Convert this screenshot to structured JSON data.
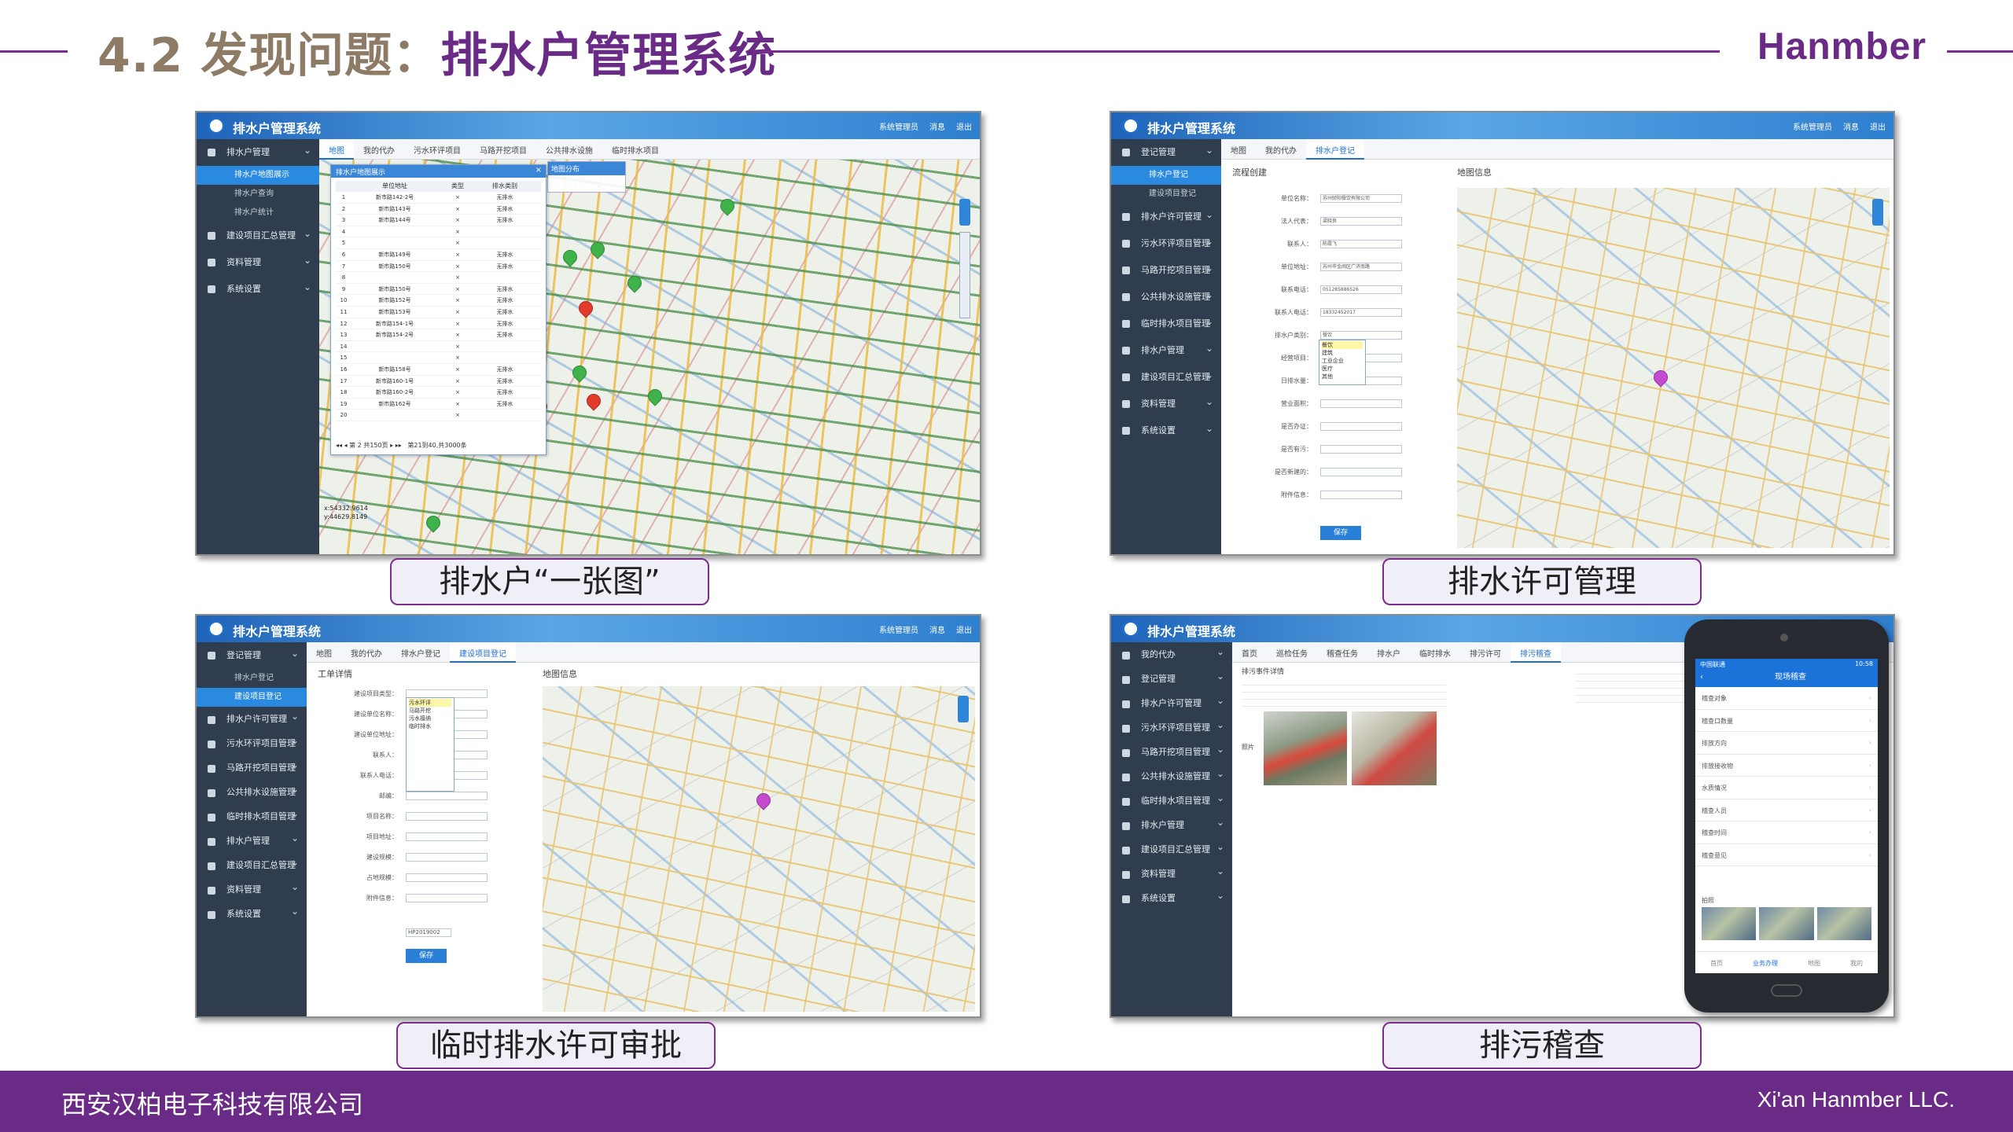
{
  "header": {
    "title_prefix": "4.2 发现问题：",
    "title_main": "排水户管理系统",
    "brand": "Hanmber"
  },
  "footer": {
    "company_cn": "西安汉柏电子科技有限公司",
    "company_en": "Xi'an Hanmber LLC."
  },
  "captions": {
    "one_map": "排水户“一张图”",
    "permit": "排水许可管理",
    "temp_permit": "临时排水许可审批",
    "inspection": "排污稽查"
  },
  "app": {
    "name": "排水户管理系统",
    "actions": [
      "系统管理员",
      "消息",
      "退出"
    ]
  },
  "panel1": {
    "tabs": [
      "地图",
      "我的代办",
      "污水环评项目",
      "马路开挖项目",
      "公共排水设施",
      "临时排水项目"
    ],
    "menu": [
      "排水户管理",
      "建设项目汇总管理",
      "资料管理",
      "系统设置"
    ],
    "submenu": [
      "排水户地图展示",
      "排水户查询",
      "排水户统计"
    ],
    "popup_title": "排水户地图展示",
    "table_headers": [
      "单位地址",
      "类型",
      "排水类别"
    ],
    "rows": [
      "新市路142-2号",
      "新市路143号",
      "新市路144号",
      "",
      "",
      "新市路149号",
      "新市路150号",
      "",
      "新市路150号",
      "新市路152号",
      "新市路153号",
      "新市路154-1号",
      "新市路154-2号",
      "",
      "",
      "新市路158号",
      "新市路160-1号",
      "新市路160-2号",
      "新市路162号",
      ""
    ],
    "drain_type": "无排水",
    "pager": "第 2 共150页",
    "total": "第21到40,共3000条",
    "coords": [
      "x:54332.9614",
      "y:44629.8149"
    ],
    "legend_title": "地图分布"
  },
  "panel2": {
    "tabs": [
      "地图",
      "我的代办",
      "排水户登记"
    ],
    "menu": [
      "登记管理",
      "排水户许可管理",
      "污水环评项目管理",
      "马路开挖项目管理",
      "公共排水设施管理",
      "临时排水项目管理",
      "排水户管理",
      "建设项目汇总管理",
      "资料管理",
      "系统设置"
    ],
    "submenu": [
      "排水户登记",
      "建设项目登记"
    ],
    "section_form": "流程创建",
    "section_map": "地图信息",
    "fields": [
      "单位名称：",
      "法人代表：",
      "联系人：",
      "单位地址：",
      "联系电话：",
      "联系人电话：",
      "排水户类别：",
      "经营项目：",
      "日排水量：",
      "营业面积：",
      "是否办证：",
      "是否有污：",
      "是否新建的：",
      "附件信息："
    ],
    "values": [
      "苏州骄阳餐饮有限公司",
      "梁晓良",
      "陈霞飞",
      "苏州市金阊区广济南路",
      "051285886526",
      "18332452017",
      "餐饮"
    ],
    "dropdown": [
      "餐饮",
      "建筑",
      "工业企业",
      "医疗",
      "其他"
    ],
    "save": "保存"
  },
  "panel3": {
    "tabs": [
      "地图",
      "我的代办",
      "排水户登记",
      "建设项目登记"
    ],
    "menu": [
      "登记管理",
      "排水户许可管理",
      "污水环评项目管理",
      "马路开挖项目管理",
      "公共排水设施管理",
      "临时排水项目管理",
      "排水户管理",
      "建设项目汇总管理",
      "资料管理",
      "系统设置"
    ],
    "submenu": [
      "排水户登记",
      "建设项目登记"
    ],
    "section_form": "工单详情",
    "section_map": "地图信息",
    "fields": [
      "建设项目类型：",
      "建设单位名称：",
      "建设单位地址：",
      "联系人：",
      "联系人电话：",
      "邮编：",
      "项目名称：",
      "项目地址：",
      "建设规模：",
      "占地规模：",
      "附件信息："
    ],
    "dropdown": [
      "污水环评",
      "马路开挖",
      "污水接纳",
      "临时排水"
    ],
    "project_no": "HP2019002",
    "save": "保存"
  },
  "panel4": {
    "tabs": [
      "首页",
      "巡检任务",
      "稽查任务",
      "排水户",
      "临时排水",
      "排污许可",
      "排污稽查"
    ],
    "menu": [
      "我的代办",
      "登记管理",
      "排水户许可管理",
      "污水环评项目管理",
      "马路开挖项目管理",
      "公共排水设施管理",
      "临时排水项目管理",
      "排水户管理",
      "建设项目汇总管理",
      "资料管理",
      "系统设置"
    ],
    "section": "排污事件详情",
    "photo_label": "照片"
  },
  "phone": {
    "status_left": "中国联通",
    "status_right": "10:58",
    "title": "现场稽查",
    "rows": [
      "稽查对象",
      "稽查口数量",
      "排放方向",
      "排放接收物",
      "水质情况",
      "稽查人员",
      "稽查时间",
      "稽查意见"
    ],
    "photo_label": "拍照",
    "nav": [
      "首页",
      "业务办理",
      "地图",
      "我的"
    ]
  }
}
